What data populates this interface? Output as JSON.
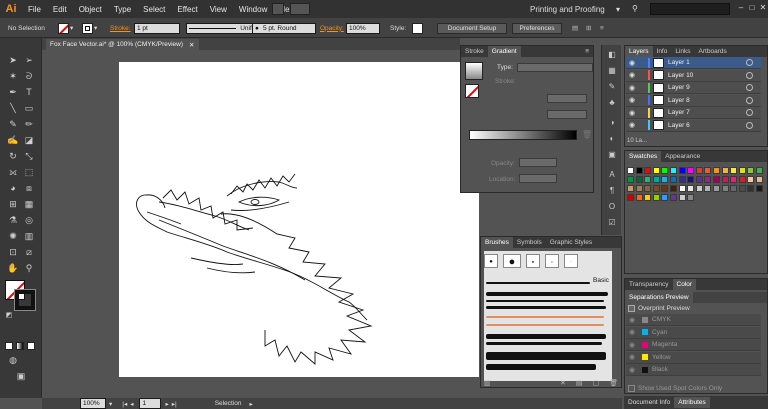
{
  "app": {
    "logo": "Ai"
  },
  "menu": [
    "File",
    "Edit",
    "Object",
    "Type",
    "Select",
    "Effect",
    "View",
    "Window",
    "Help"
  ],
  "workspace": {
    "label": "Printing and Proofing"
  },
  "control": {
    "selection_label": "No Selection",
    "stroke_label": "Stroke:",
    "stroke_weight": "1 pt",
    "profile": "Uniform",
    "brush": "5 pt. Round",
    "opacity_label": "Opacity:",
    "opacity_value": "100%",
    "style_label": "Style:",
    "doc_setup": "Document Setup",
    "preferences": "Preferences"
  },
  "document": {
    "tab_title": "Fox Face Vector.ai* @ 100% (CMYK/Preview)"
  },
  "gradient_panel": {
    "tabs": [
      "Stroke",
      "Gradient"
    ],
    "type_label": "Type:",
    "stroke_label": "Stroke:",
    "opacity_label": "Opacity:",
    "location_label": "Location:"
  },
  "layers_panel": {
    "tabs": [
      "Layers",
      "Info",
      "Links",
      "Artboards"
    ],
    "layers": [
      {
        "name": "Layer 1",
        "color": "#4f7fff",
        "selected": true
      },
      {
        "name": "Layer 10",
        "color": "#ff4f4f",
        "selected": false
      },
      {
        "name": "Layer 9",
        "color": "#4fd04f",
        "selected": false
      },
      {
        "name": "Layer 8",
        "color": "#3f6fff",
        "selected": false
      },
      {
        "name": "Layer 7",
        "color": "#ffd23f",
        "selected": false
      },
      {
        "name": "Layer 6",
        "color": "#3fc8ff",
        "selected": false
      }
    ],
    "footer": "10 La..."
  },
  "swatches_panel": {
    "tabs": [
      "Swatches",
      "Appearance"
    ]
  },
  "brushes_panel": {
    "tabs": [
      "Brushes",
      "Symbols",
      "Graphic Styles"
    ],
    "basic_label": "Basic"
  },
  "color_panel": {
    "tabs": [
      "Transparency",
      "Color"
    ]
  },
  "separations_panel": {
    "title": "Separations Preview",
    "overprint": "Overprint Preview",
    "plates": [
      {
        "name": "CMYK",
        "color": "#888888"
      },
      {
        "name": "Cyan",
        "color": "#00b4ef"
      },
      {
        "name": "Magenta",
        "color": "#e6007e"
      },
      {
        "name": "Yellow",
        "color": "#ffe600"
      },
      {
        "name": "Black",
        "color": "#111111"
      }
    ],
    "spot_only": "Show Used Spot Colors Only"
  },
  "bottom_tabs": [
    "Document Info",
    "Attributes"
  ],
  "status": {
    "zoom": "100%",
    "page": "1",
    "tool": "Selection"
  }
}
